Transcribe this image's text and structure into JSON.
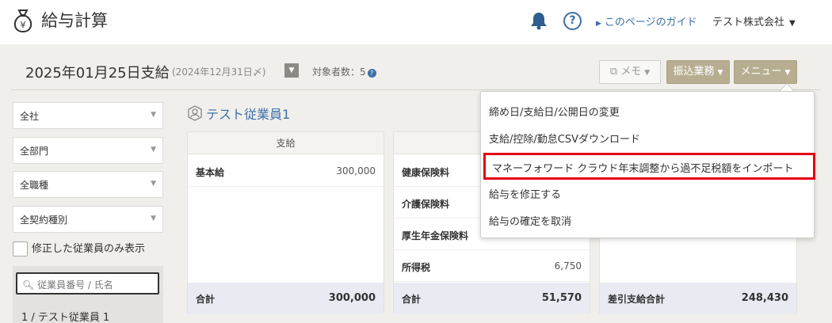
{
  "header": {
    "app_title": "給与計算",
    "guide_link": "このページのガイド",
    "company": "テスト株式会社",
    "help_label": "?"
  },
  "payroll": {
    "title": "2025年01月25日支給",
    "closing_note": "(2024年12月31日〆)",
    "employee_count": "対象者数：5",
    "buttons": {
      "memo": "メモ",
      "transfer": "振込業務",
      "menu": "メニュー"
    }
  },
  "filters": {
    "company": "全社",
    "department": "全部門",
    "job_type": "全職種",
    "contract_type": "全契約種別",
    "modified_only_label": "修正した従業員のみ表示",
    "search_placeholder": "従業員番号 / 氏名",
    "employee_list": [
      "1 / テスト従業員 1"
    ]
  },
  "employee": {
    "name": "テスト従業員1",
    "payments": {
      "header": "支給",
      "rows": [
        {
          "label": "基本給",
          "value": "300,000"
        }
      ],
      "total_label": "合計",
      "total_value": "300,000"
    },
    "deductions": {
      "rows": [
        {
          "label": "健康保険料",
          "value": ""
        },
        {
          "label": "介護保険料",
          "value": ""
        },
        {
          "label": "厚生年金保険料",
          "value": ""
        },
        {
          "label": "所得税",
          "value": "6,750"
        }
      ],
      "total_label": "合計",
      "total_value": "51,570"
    },
    "net": {
      "total_label": "差引支給合計",
      "total_value": "248,430"
    }
  },
  "menu_dropdown": {
    "items": [
      "締め日/支給日/公開日の変更",
      "支給/控除/勤怠CSVダウンロード",
      "マネーフォワード クラウド年末調整から過不足税額をインポート",
      "給与を修正する",
      "給与の確定を取消"
    ],
    "highlighted_index": 2
  },
  "colors": {
    "accent": "#3d6fa8",
    "button": "#b7ae92",
    "highlight": "#e60012"
  }
}
